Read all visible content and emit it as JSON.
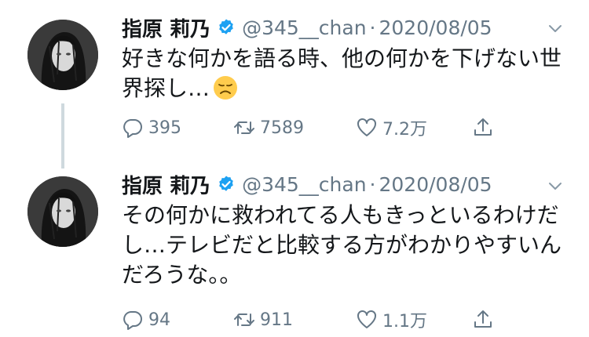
{
  "colors": {
    "text_primary": "#14171a",
    "text_secondary": "#657786",
    "verified_blue": "#1da1f2",
    "thread_line": "#cfd9de"
  },
  "icons": {
    "reply": "speech-bubble-icon",
    "retweet": "retweet-arrows-icon",
    "like": "heart-icon",
    "share": "share-upload-icon",
    "verified": "verified-badge-icon",
    "more": "chevron-down-icon",
    "emoji": "disappointed-face-emoji"
  },
  "tweets": [
    {
      "name": "指原 莉乃",
      "handle": "@345__chan",
      "separator": "·",
      "date": "2020/08/05",
      "text_lines": [
        "好きな何かを語る時、他の何かを下げない世",
        "界探し…"
      ],
      "emoji": "😞",
      "replies": "395",
      "retweets": "7589",
      "likes": "7.2万"
    },
    {
      "name": "指原 莉乃",
      "handle": "@345__chan",
      "separator": "·",
      "date": "2020/08/05",
      "text_lines": [
        "その何かに救われてる人もきっといるわけだ",
        "し…テレビだと比較する方がわかりやすいん",
        "だろうな。。"
      ],
      "replies": "94",
      "retweets": "911",
      "likes": "1.1万"
    }
  ]
}
